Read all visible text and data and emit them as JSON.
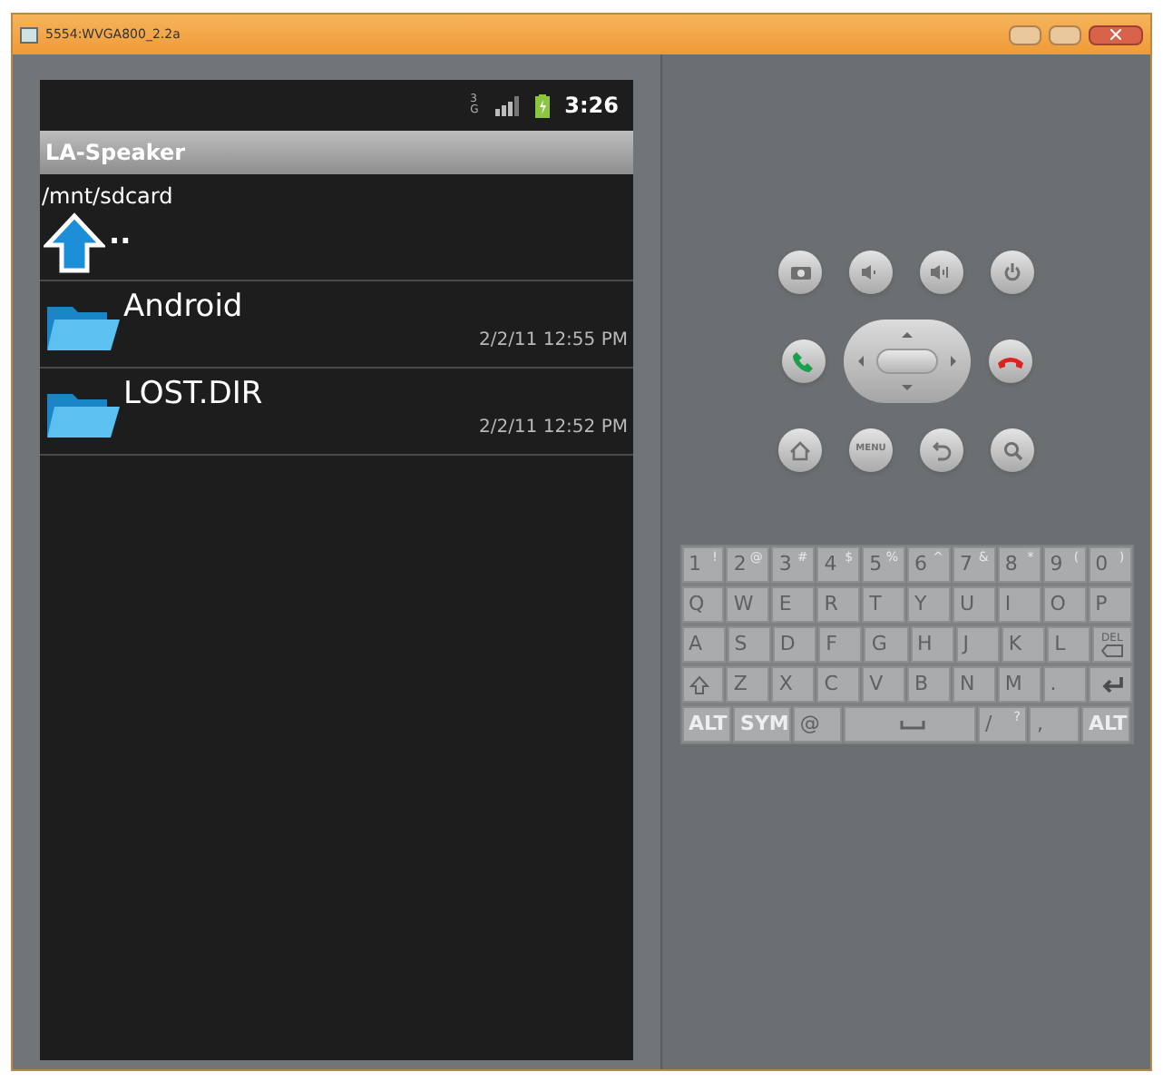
{
  "window": {
    "title": "5554:WVGA800_2.2a"
  },
  "status_bar": {
    "network": "3G",
    "time": "3:26"
  },
  "app_bar": {
    "title": "LA-Speaker"
  },
  "path": "/mnt/sdcard",
  "files": [
    {
      "kind": "parent",
      "name": ".."
    },
    {
      "kind": "folder",
      "name": "Android",
      "modified": "2/2/11 12:55 PM"
    },
    {
      "kind": "folder",
      "name": "LOST.DIR",
      "modified": "2/2/11 12:52 PM"
    }
  ],
  "menu_key": "MENU",
  "keyboard": [
    [
      {
        "label": "1",
        "alt": "!"
      },
      {
        "label": "2",
        "alt": "@"
      },
      {
        "label": "3",
        "alt": "#"
      },
      {
        "label": "4",
        "alt": "$"
      },
      {
        "label": "5",
        "alt": "%"
      },
      {
        "label": "6",
        "alt": "^"
      },
      {
        "label": "7",
        "alt": "&"
      },
      {
        "label": "8",
        "alt": "*"
      },
      {
        "label": "9",
        "alt": "("
      },
      {
        "label": "0",
        "alt": ")"
      }
    ],
    [
      {
        "label": "Q"
      },
      {
        "label": "W"
      },
      {
        "label": "E"
      },
      {
        "label": "R"
      },
      {
        "label": "T"
      },
      {
        "label": "Y"
      },
      {
        "label": "U"
      },
      {
        "label": "I"
      },
      {
        "label": "O"
      },
      {
        "label": "P"
      }
    ],
    [
      {
        "label": "A"
      },
      {
        "label": "S"
      },
      {
        "label": "D"
      },
      {
        "label": "F"
      },
      {
        "label": "G"
      },
      {
        "label": "H"
      },
      {
        "label": "J"
      },
      {
        "label": "K"
      },
      {
        "label": "L"
      },
      {
        "label": "DEL",
        "kind": "del"
      }
    ],
    [
      {
        "kind": "shift"
      },
      {
        "label": "Z"
      },
      {
        "label": "X"
      },
      {
        "label": "C"
      },
      {
        "label": "V"
      },
      {
        "label": "B"
      },
      {
        "label": "N"
      },
      {
        "label": "M"
      },
      {
        "label": "."
      },
      {
        "kind": "enter"
      }
    ],
    [
      {
        "label": "ALT",
        "kind": "small"
      },
      {
        "label": "SYM",
        "kind": "small"
      },
      {
        "label": "@"
      },
      {
        "kind": "space"
      },
      {
        "label": "/",
        "alt": "?"
      },
      {
        "label": ","
      },
      {
        "label": "ALT",
        "kind": "small"
      }
    ]
  ]
}
